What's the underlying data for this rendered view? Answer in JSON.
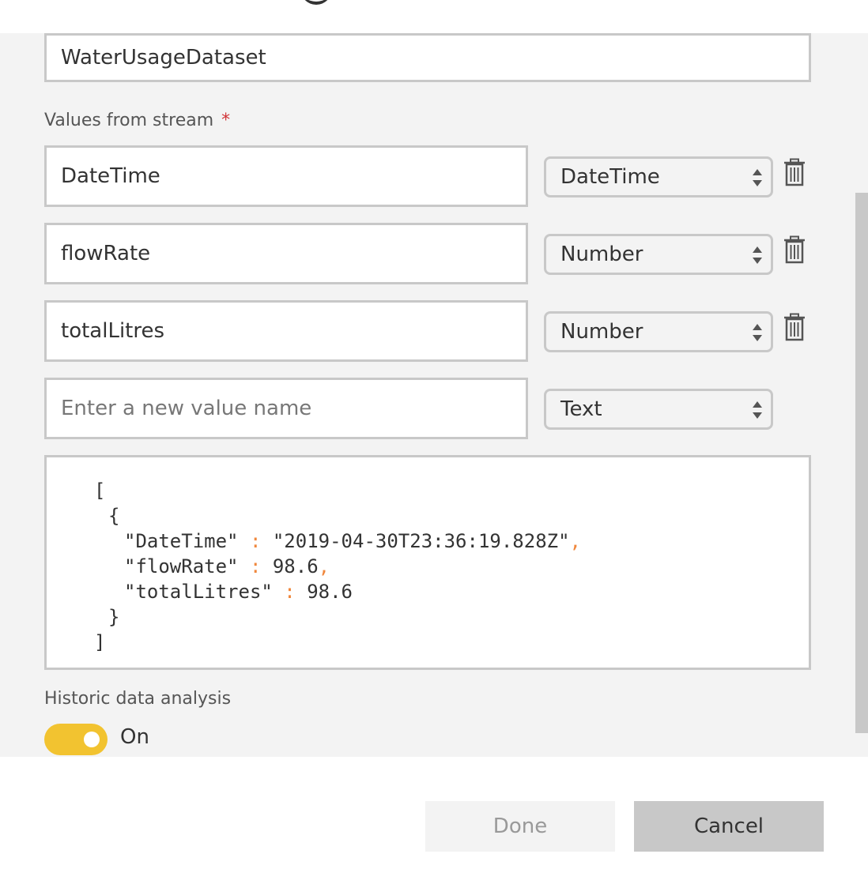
{
  "dataset": {
    "name": "WaterUsageDataset"
  },
  "values_section": {
    "label": "Values from stream",
    "required_marker": "*"
  },
  "rows": [
    {
      "name": "DateTime",
      "type": "DateTime"
    },
    {
      "name": "flowRate",
      "type": "Number"
    },
    {
      "name": "totalLitres",
      "type": "Number"
    }
  ],
  "new_row": {
    "placeholder": "Enter a new value name",
    "type": "Text"
  },
  "json_preview": {
    "open_bracket": "[",
    "open_brace": "{",
    "line1_key": "\"DateTime\"",
    "line1_sep": ":",
    "line1_val": "\"2019-04-30T23:36:19.828Z\"",
    "line1_comma": ",",
    "line2_key": "\"flowRate\"",
    "line2_sep": ":",
    "line2_val": "98.6",
    "line2_comma": ",",
    "line3_key": "\"totalLitres\"",
    "line3_sep": ":",
    "line3_val": "98.6",
    "close_brace": "}",
    "close_bracket": "]"
  },
  "historic": {
    "label": "Historic data analysis",
    "toggle_state": "On"
  },
  "footer": {
    "done_label": "Done",
    "cancel_label": "Cancel"
  },
  "colors": {
    "accent_toggle": "#f2c330",
    "required": "#d13438",
    "json_punctuation": "#f0873c"
  }
}
